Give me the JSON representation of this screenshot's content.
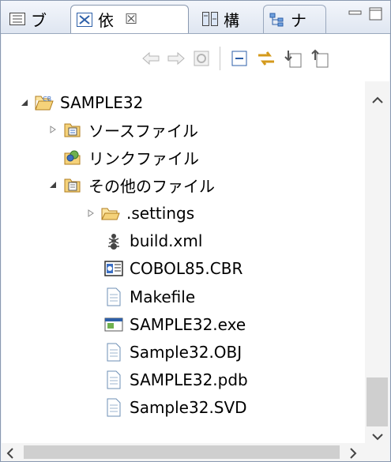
{
  "tabs": [
    {
      "label": "ブ",
      "icon": "outline-icon"
    },
    {
      "label": "依",
      "icon": "dependency-icon",
      "active": true
    },
    {
      "label": "構",
      "icon": "structure-icon"
    },
    {
      "label": "ナ",
      "icon": "navigator-icon"
    }
  ],
  "tab_close": "☒",
  "tree": {
    "root": "SAMPLE32",
    "source_files": "ソースファイル",
    "link_files": "リンクファイル",
    "other_files": "その他のファイル",
    "children": [
      ".settings",
      "build.xml",
      "COBOL85.CBR",
      "Makefile",
      "SAMPLE32.exe",
      "Sample32.OBJ",
      "SAMPLE32.pdb",
      "Sample32.SVD"
    ]
  },
  "colors": {
    "accent": "#3b6fc4",
    "folder": "#e8b64c",
    "frame": "#8a99b0"
  }
}
